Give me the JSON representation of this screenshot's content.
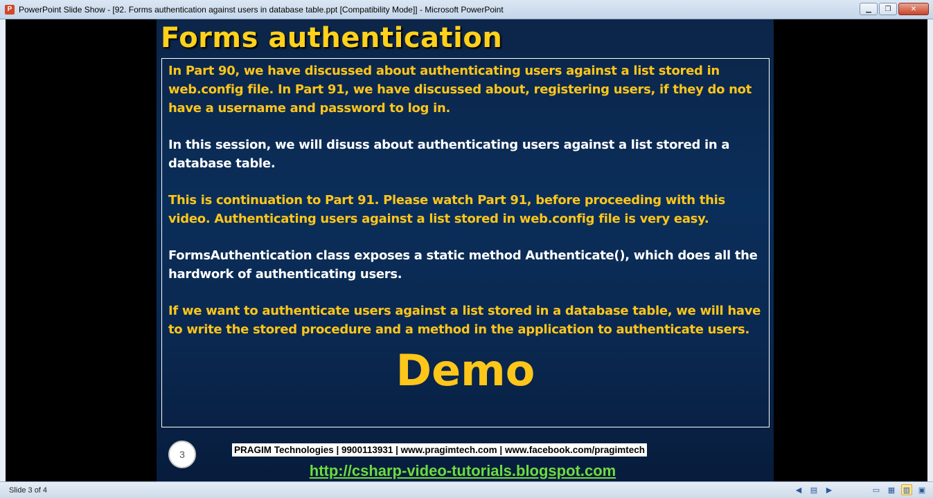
{
  "window": {
    "app_icon": "P",
    "title": "PowerPoint Slide Show - [92. Forms authentication against users in database table.ppt [Compatibility Mode]] - Microsoft PowerPoint",
    "minimize_icon": "minimize-icon",
    "restore_icon": "restore-icon",
    "close_icon": "close-icon"
  },
  "slide": {
    "title": "Forms authentication",
    "paragraphs": [
      {
        "text": "In Part 90, we have discussed about authenticating users against a list stored in web.config file. In Part 91, we have discussed about, registering users, if they do not have a username and password to log in.",
        "color": "#ffc61a"
      },
      {
        "text": "In this session, we will disuss about authenticating users against a list stored in a database table.",
        "color": "#ffffff"
      },
      {
        "text": "This is continuation to Part 91. Please watch Part 91, before proceeding with this video. Authenticating users against a list stored in web.config file is very easy.",
        "color": "#ffc61a"
      },
      {
        "text": "FormsAuthentication class exposes a static method Authenticate(), which does all the hardwork of authenticating users.",
        "color": "#ffffff"
      },
      {
        "text": "If we want to authenticate users against a list stored in a database table, we will have to write the stored procedure and a method in the application to authenticate users.",
        "color": "#ffc61a"
      }
    ],
    "demo": "Demo",
    "number": "3",
    "company": "PRAGIM Technologies | 9900113931 | www.pragimtech.com | www.facebook.com/pragimtech",
    "blog_link": "http://csharp-video-tutorials.blogspot.com"
  },
  "statusbar": {
    "slide_indicator": "Slide 3 of 4",
    "icons": [
      "previous-icon",
      "menu-icon",
      "next-icon",
      "normal-view-icon",
      "slide-sorter-icon",
      "reading-view-icon",
      "slide-show-icon"
    ]
  }
}
